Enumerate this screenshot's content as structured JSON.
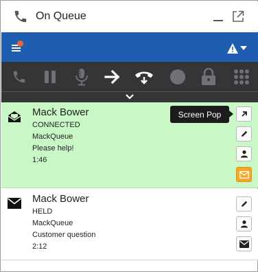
{
  "window": {
    "title": "On Queue"
  },
  "toolbar": {
    "buttons": [
      "call",
      "hold",
      "mute",
      "transfer",
      "disconnect",
      "record",
      "secure-pause",
      "dialpad"
    ]
  },
  "tooltip": {
    "text": "Screen Pop"
  },
  "interactions": [
    {
      "name": "Mack Bower",
      "state": "CONNECTED",
      "queue": "MackQueue",
      "subject": "Please help!",
      "duration": "1:46",
      "icon": "envelope-open-icon",
      "actions": [
        "screen-pop",
        "edit",
        "contact",
        "email"
      ]
    },
    {
      "name": "Mack Bower",
      "state": "HELD",
      "queue": "MackQueue",
      "subject": "Customer question",
      "duration": "2:12",
      "icon": "envelope-icon",
      "actions": [
        "edit",
        "contact",
        "email"
      ]
    }
  ],
  "colors": {
    "header": "#1f5db1",
    "toolbar": "#333537",
    "active_card": "#c9f7c5",
    "badge": "#f0623a",
    "email_action": "#f5a623"
  }
}
